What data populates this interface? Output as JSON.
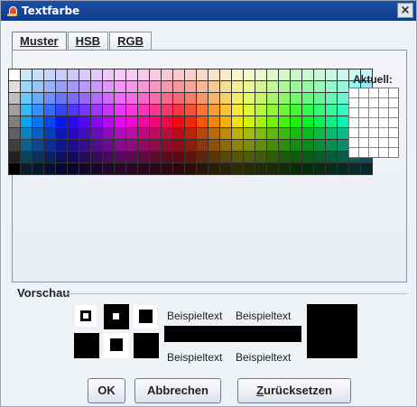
{
  "window": {
    "title": "Textfarbe"
  },
  "tabs": [
    {
      "label": "Muster",
      "active": true
    },
    {
      "label": "HSB",
      "active": false
    },
    {
      "label": "RGB",
      "active": false
    }
  ],
  "palette": {
    "columns": 31,
    "rows": 9
  },
  "recent": {
    "label": "Aktuell:",
    "columns": 5,
    "rows": 7
  },
  "preview": {
    "label": "Vorschau",
    "sample_text": "Beispieltext",
    "foreground": "#000000",
    "background": "#ffffff"
  },
  "buttons": {
    "ok": "OK",
    "cancel": "Abbrechen",
    "reset_prefix": "Z",
    "reset_rest": "urücksetzen"
  },
  "colors": {
    "title_bar": "#1b4fa8",
    "panel": "#eef1f5"
  }
}
